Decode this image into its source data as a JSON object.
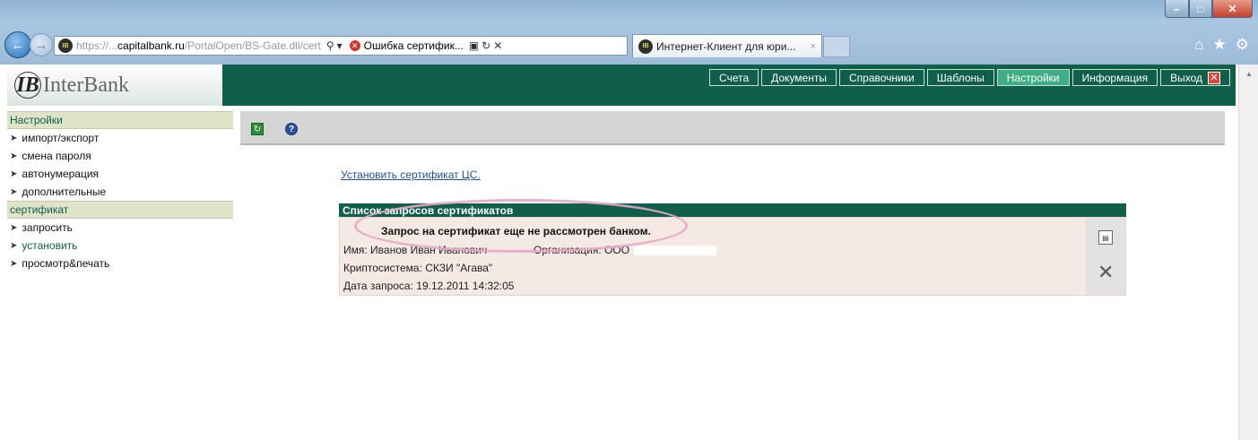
{
  "browser": {
    "address": {
      "url_prefix": "https://...",
      "url_host": "capitalbank.ru",
      "url_path": "/PortalOpen/BS-Gate.dll/cert",
      "cert_error": "Ошибка сертифик..."
    },
    "tab": {
      "label": "Интернет-Клиент для юри...",
      "close": "×"
    },
    "site_icon": "IB",
    "window_buttons": {
      "minimize": "–",
      "maximize": "□",
      "close": "✕"
    }
  },
  "app": {
    "logo": {
      "mark": "IB",
      "text": "InterBank"
    },
    "menu": [
      {
        "label": "Счета"
      },
      {
        "label": "Документы"
      },
      {
        "label": "Справочники"
      },
      {
        "label": "Шаблоны"
      },
      {
        "label": "Настройки"
      },
      {
        "label": "Информация"
      },
      {
        "label": "Выход"
      }
    ],
    "menu_active": "Настройки"
  },
  "sidebar": {
    "section1": {
      "title": "Настройки",
      "items": [
        "импорт/экспорт",
        "смена пароля",
        "автонумерация",
        "дополнительные"
      ]
    },
    "section2": {
      "title": "сертификат",
      "items": [
        "запросить",
        "установить",
        "просмотр&печать"
      ]
    }
  },
  "main": {
    "install_link": "Установить сертификат ЦС.",
    "panel": {
      "title": "Список запросов сертификатов",
      "status": "Запрос на сертификат еще не рассмотрен банком.",
      "name_label": "Имя: Иванов Иван Иванович",
      "org_label": "Организация: ООО",
      "crypto": "Криптосистема: СКЗИ \"Агава\"",
      "date": "Дата запроса: 19.12.2011 14:32:05"
    }
  },
  "colors": {
    "header_green": "#0f5f4a",
    "active_menu": "#3fae82",
    "sidebar_head": "#dfe4c9",
    "panel_body": "#f5e9e4",
    "highlight_ring": "#e9a6c9"
  }
}
